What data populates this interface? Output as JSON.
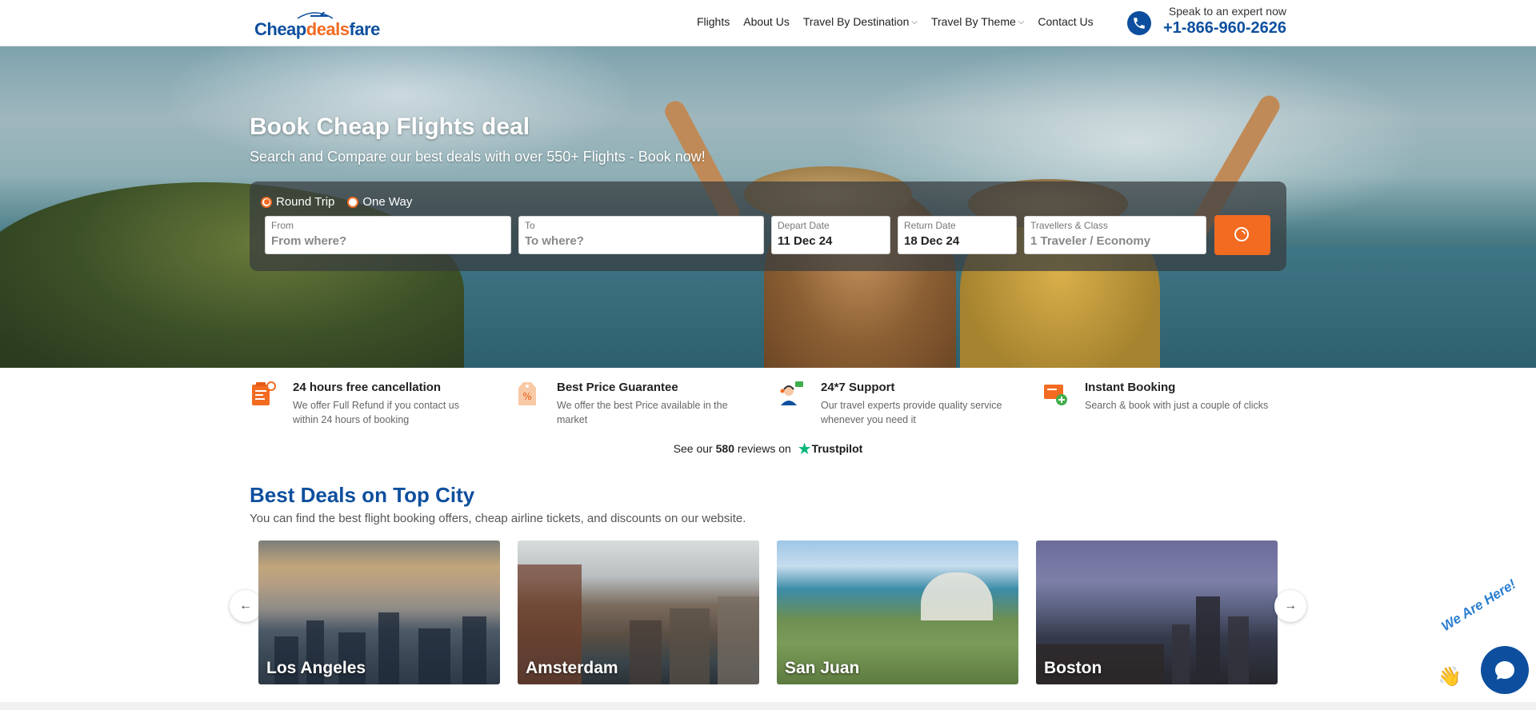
{
  "header": {
    "logo": {
      "part1": "Cheap",
      "part2": "deals",
      "part3": "fare"
    },
    "nav": [
      {
        "label": "Flights",
        "dropdown": false
      },
      {
        "label": "About Us",
        "dropdown": false
      },
      {
        "label": "Travel By Destination",
        "dropdown": true
      },
      {
        "label": "Travel By Theme",
        "dropdown": true
      },
      {
        "label": "Contact Us",
        "dropdown": false
      }
    ],
    "phone": {
      "caption": "Speak to an expert now",
      "number": "+1-866-960-2626",
      "icon": "phone-icon"
    }
  },
  "hero": {
    "title": "Book Cheap Flights deal",
    "subtitle": "Search and Compare our best deals with over 550+ Flights - Book now!"
  },
  "search": {
    "trip_types": [
      {
        "label": "Round Trip",
        "selected": true
      },
      {
        "label": "One Way",
        "selected": false
      }
    ],
    "from": {
      "label": "From",
      "placeholder": "From where?"
    },
    "to": {
      "label": "To",
      "placeholder": "To where?"
    },
    "depart": {
      "label": "Depart Date",
      "value": "11 Dec 24"
    },
    "return": {
      "label": "Return Date",
      "value": "18 Dec 24"
    },
    "travellers": {
      "label": "Travellers & Class",
      "placeholder": "1 Traveler / Economy"
    },
    "button_icon": "search-icon"
  },
  "features": [
    {
      "title": "24 hours free cancellation",
      "desc": "We offer Full Refund if you contact us within 24 hours of booking",
      "icon": "cancellation-icon"
    },
    {
      "title": "Best Price Guarantee",
      "desc": "We offer the best Price available in the market",
      "icon": "price-tag-icon"
    },
    {
      "title": "24*7 Support",
      "desc": "Our travel experts provide quality service whenever you need it",
      "icon": "support-agent-icon"
    },
    {
      "title": "Instant Booking",
      "desc": "Search & book with just a couple of clicks",
      "icon": "instant-booking-icon"
    }
  ],
  "trustpilot": {
    "prefix": "See our",
    "count": "580",
    "suffix": "reviews on",
    "brand": "Trustpilot"
  },
  "deals": {
    "title": "Best Deals on Top City",
    "subtitle": "You can find the best flight booking offers, cheap airline tickets, and discounts on our website.",
    "cities": [
      "Los Angeles",
      "Amsterdam",
      "San Juan",
      "Boston"
    ],
    "prev_icon": "←",
    "next_icon": "→"
  },
  "chat": {
    "text": "We Are Here!"
  },
  "colors": {
    "brand_blue": "#0d4f9e",
    "accent_orange": "#f26b21",
    "trustpilot_green": "#00b67a"
  }
}
